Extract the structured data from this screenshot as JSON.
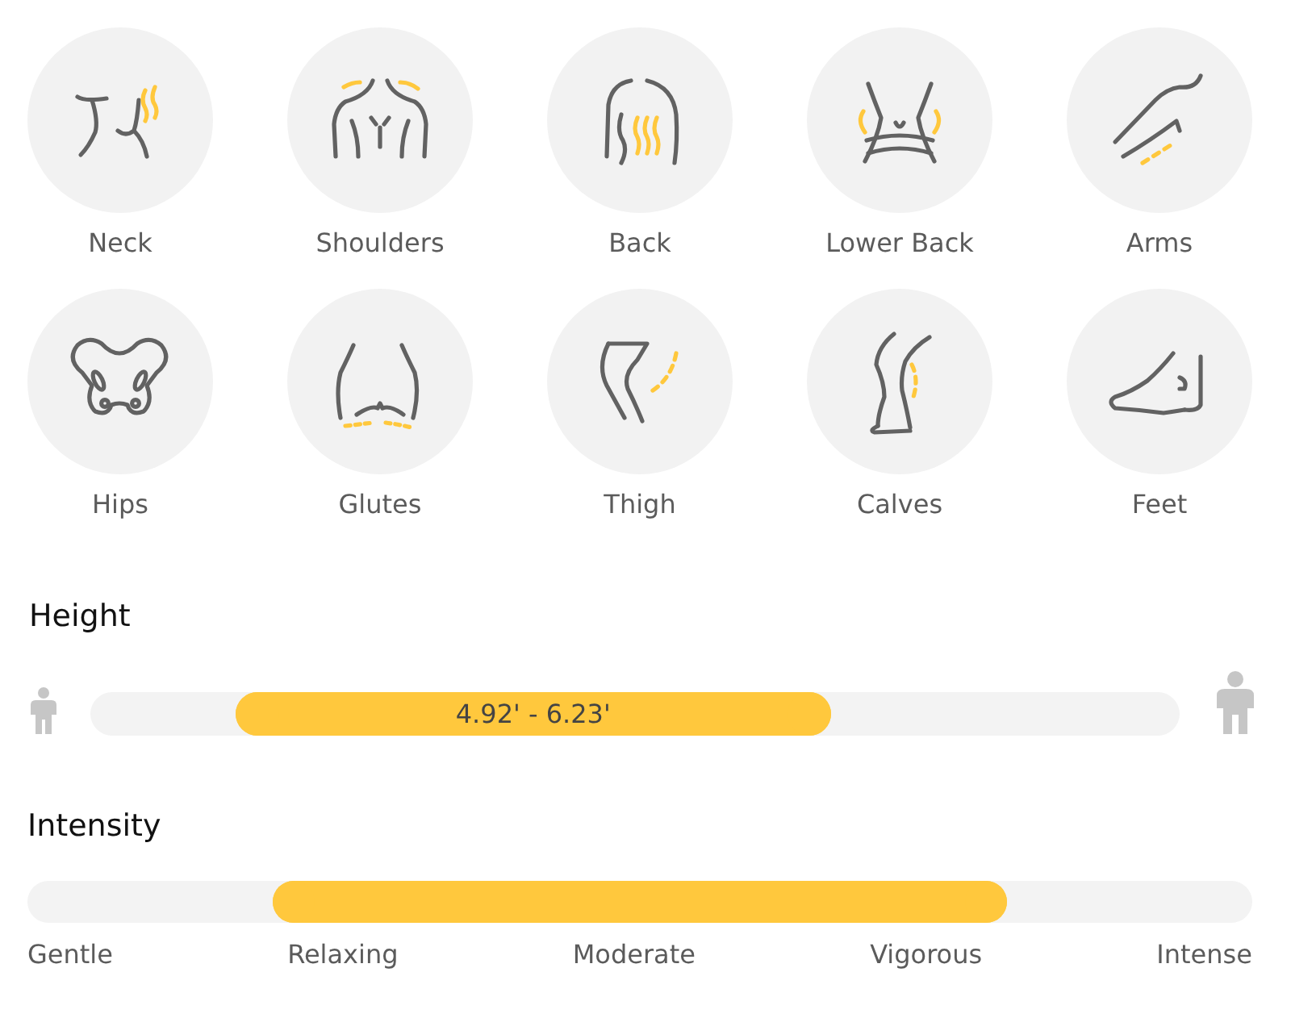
{
  "body_parts": [
    {
      "label": "Neck",
      "kind": "neck"
    },
    {
      "label": "Shoulders",
      "kind": "shoulders"
    },
    {
      "label": "Back",
      "kind": "back"
    },
    {
      "label": "Lower Back",
      "kind": "lower_back"
    },
    {
      "label": "Arms",
      "kind": "arms"
    },
    {
      "label": "Hips",
      "kind": "hips"
    },
    {
      "label": "Glutes",
      "kind": "glutes"
    },
    {
      "label": "Thigh",
      "kind": "thigh"
    },
    {
      "label": "Calves",
      "kind": "calves"
    },
    {
      "label": "Feet",
      "kind": "feet"
    }
  ],
  "height": {
    "title": "Height",
    "value": "4.92' - 6.23'",
    "handles": [
      {
        "level": 0.153
      },
      {
        "level": 0.66
      }
    ]
  },
  "intensity": {
    "title": "Intensity",
    "handles": [
      {
        "level": 0.217
      },
      {
        "level": 0.782
      }
    ],
    "labels": [
      "Gentle",
      "Relaxing",
      "Moderate",
      "Vigorous",
      "Intense"
    ]
  }
}
